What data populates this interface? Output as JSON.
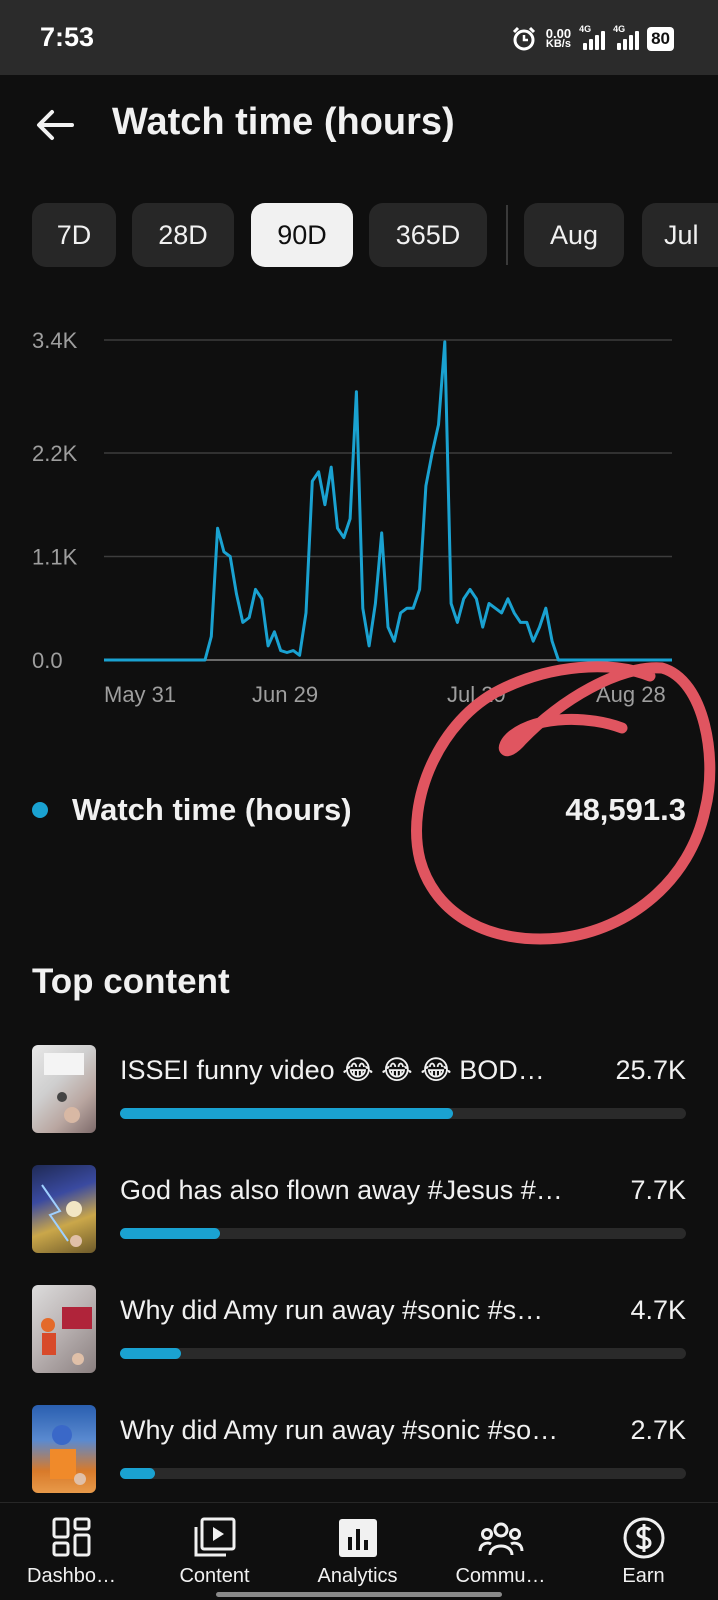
{
  "status_bar": {
    "time": "7:53",
    "net_speed": "0.00",
    "net_unit": "KB/s",
    "sim1": "4G",
    "sim2": "4G",
    "battery": "80"
  },
  "header": {
    "title": "Watch time (hours)",
    "back_icon": "arrow-left-icon"
  },
  "chips": [
    {
      "label": "7D",
      "selected": false
    },
    {
      "label": "28D",
      "selected": false
    },
    {
      "label": "90D",
      "selected": true
    },
    {
      "label": "365D",
      "selected": false
    },
    {
      "label": "Aug",
      "selected": false
    },
    {
      "label": "Jul",
      "selected": false
    }
  ],
  "chart_data": {
    "type": "line",
    "title": "",
    "xlabel": "",
    "ylabel": "",
    "y_ticks": [
      "0.0",
      "1.1K",
      "2.2K",
      "3.4K"
    ],
    "x_ticks": [
      "May 31",
      "Jun 29",
      "Jul 29",
      "Aug 28"
    ],
    "ylim": [
      0,
      3400
    ],
    "grid": true,
    "series": [
      {
        "color": "#1aa2d1",
        "values": [
          0,
          0,
          0,
          0,
          0,
          0,
          0,
          0,
          0,
          0,
          0,
          0,
          0,
          0,
          0,
          0,
          0,
          250,
          1400,
          1150,
          1100,
          700,
          400,
          450,
          750,
          650,
          150,
          300,
          100,
          80,
          100,
          50,
          500,
          1900,
          2000,
          1650,
          2050,
          1400,
          1300,
          1500,
          2850,
          550,
          150,
          600,
          1350,
          350,
          200,
          500,
          550,
          550,
          750,
          1850,
          2200,
          2500,
          3380,
          600,
          400,
          650,
          750,
          650,
          350,
          600,
          550,
          500,
          650,
          500,
          400,
          400,
          200,
          350,
          550,
          200,
          0,
          0,
          0,
          0,
          0,
          0,
          0,
          0,
          0,
          0,
          0,
          0,
          0,
          0,
          0,
          0,
          0,
          0,
          0
        ]
      }
    ]
  },
  "metric": {
    "label": "Watch time (hours)",
    "value": "48,591.3",
    "dot_color": "#1aa2d1"
  },
  "annotation_color": "#e05560",
  "top_content": {
    "title": "Top content",
    "items": [
      {
        "title": "ISSEI funny video 😂 😂 😂 BOD…",
        "value": "25.7K",
        "fraction": 0.588
      },
      {
        "title": "God has also flown away #Jesus #…",
        "value": "7.7K",
        "fraction": 0.177
      },
      {
        "title": "Why did Amy run away #sonic #s…",
        "value": "4.7K",
        "fraction": 0.108
      },
      {
        "title": "Why did Amy run away #sonic #so…",
        "value": "2.7K",
        "fraction": 0.062
      }
    ]
  },
  "bottom_nav": [
    {
      "label": "Dashbo…",
      "icon": "dashboard-icon"
    },
    {
      "label": "Content",
      "icon": "content-library-icon"
    },
    {
      "label": "Analytics",
      "icon": "analytics-icon",
      "selected": true
    },
    {
      "label": "Commu…",
      "icon": "community-icon"
    },
    {
      "label": "Earn",
      "icon": "dollar-icon"
    }
  ]
}
